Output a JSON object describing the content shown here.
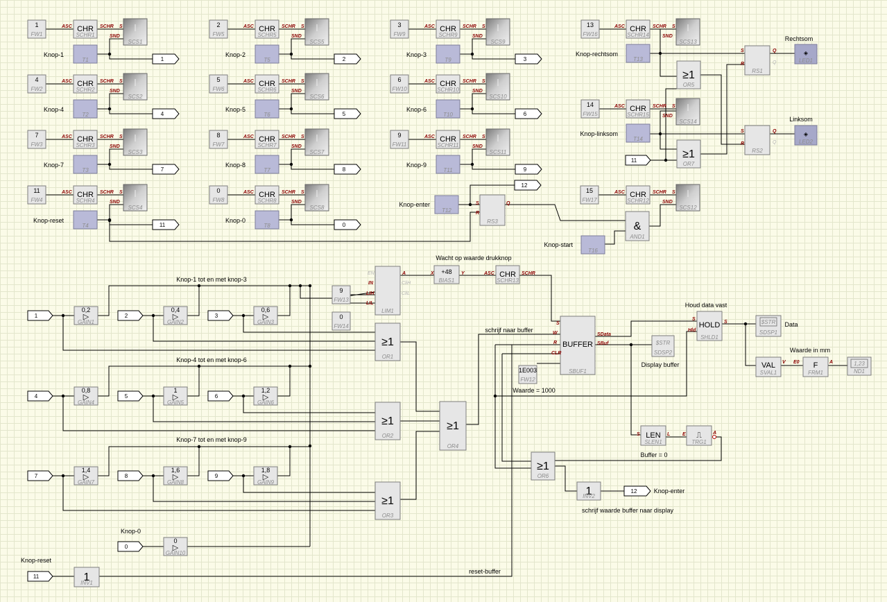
{
  "buttons": [
    {
      "label": "Knop-1",
      "fw_value": "1",
      "fw_id": "FW1",
      "chr_id": "SCHR1",
      "scs_id": "SCS1",
      "t_id": "T1",
      "out": "1"
    },
    {
      "label": "Knop-2",
      "fw_value": "2",
      "fw_id": "FW5",
      "chr_id": "SCHR5",
      "scs_id": "SCS5",
      "t_id": "T5",
      "out": "2"
    },
    {
      "label": "Knop-3",
      "fw_value": "3",
      "fw_id": "FW9",
      "chr_id": "SCHR9",
      "scs_id": "SCS9",
      "t_id": "T9",
      "out": "3"
    },
    {
      "label": "Knop-4",
      "fw_value": "4",
      "fw_id": "FW2",
      "chr_id": "SCHR2",
      "scs_id": "SCS2",
      "t_id": "T2",
      "out": "4"
    },
    {
      "label": "Knop-5",
      "fw_value": "5",
      "fw_id": "FW6",
      "chr_id": "SCHR6",
      "scs_id": "SCS6",
      "t_id": "T6",
      "out": "5"
    },
    {
      "label": "Knop-6",
      "fw_value": "6",
      "fw_id": "FW10",
      "chr_id": "SCHR10",
      "scs_id": "SCS10",
      "t_id": "T10",
      "out": "6"
    },
    {
      "label": "Knop-7",
      "fw_value": "7",
      "fw_id": "FW3",
      "chr_id": "SCHR3",
      "scs_id": "SCS3",
      "t_id": "T3",
      "out": "7"
    },
    {
      "label": "Knop-8",
      "fw_value": "8",
      "fw_id": "FW7",
      "chr_id": "SCHR7",
      "scs_id": "SCS7",
      "t_id": "T7",
      "out": "8"
    },
    {
      "label": "Knop-9",
      "fw_value": "9",
      "fw_id": "FW11",
      "chr_id": "SCHR11",
      "scs_id": "SCS11",
      "t_id": "T11",
      "out": "9"
    },
    {
      "label": "Knop-reset",
      "fw_value": "11",
      "fw_id": "FW4",
      "chr_id": "SCHR4",
      "scs_id": "SCS4",
      "t_id": "T4",
      "out": "11"
    },
    {
      "label": "Knop-0",
      "fw_value": "0",
      "fw_id": "FW8",
      "chr_id": "SCHR8",
      "scs_id": "SCS8",
      "t_id": "T8",
      "out": "0"
    }
  ],
  "rechtsom": {
    "label": "Knop-rechtsom",
    "fw_value": "13",
    "fw_id": "FW16",
    "chr_id": "SCHR14",
    "scs_id": "SCS13",
    "t_id": "T13",
    "or_id": "OR5",
    "rs_id": "RS1",
    "led_id": "LED1",
    "led_caption": "Rechtsom"
  },
  "linksom": {
    "label": "Knop-linksom",
    "fw_value": "14",
    "fw_id": "FW15",
    "chr_id": "SCHR15",
    "scs_id": "SCS14",
    "t_id": "T14",
    "or_id": "OR7",
    "rs_id": "RS2",
    "led_id": "LED2",
    "led_caption": "Linksom",
    "in_value": "11"
  },
  "enter": {
    "label": "Knop-enter",
    "t_id": "T12",
    "rs_id": "RS3",
    "out": "12"
  },
  "start": {
    "label": "Knop-start",
    "t_id": "T16",
    "and_id": "AND1",
    "fw_value": "15",
    "fw_id": "FW17",
    "chr_id": "SCHR12",
    "scs_id": "SCS12"
  },
  "pins": {
    "asc": "ASC",
    "schr": "SCHR",
    "s": "S",
    "snd": "SND",
    "r": "R",
    "q": "Q",
    "q2": "Q",
    "x": "X",
    "y": "Y",
    "a": "A",
    "en": "EN",
    "in": "IN",
    "lih": "LIH",
    "lil": "LIL",
    "clih": "CliH",
    "clil": "CliL",
    "w": "W",
    "clr": "CLR",
    "sdata": "SData",
    "sbuf": "SBuf",
    "hld": "Hld",
    "v": "V",
    "e0": "E0",
    "l": "L",
    "e": "E"
  },
  "symbols": {
    "chr": "CHR",
    "or": "≥1",
    "and": "&",
    "inv": "1",
    "gain": "▷",
    "buffer": "BUFFER",
    "hold": "HOLD",
    "val": "VAL",
    "frm": "F",
    "len": "LEN",
    "trg": "⎍",
    "sdsp": "$STR",
    "nd": "1,23",
    "led": "◈"
  },
  "gain_values": [
    "0,2",
    "0,4",
    "0,6",
    "0,8",
    "1",
    "1,2",
    "1,4",
    "1,6",
    "1,8",
    "0"
  ],
  "gain_ids": [
    "GAIN1",
    "GAIN2",
    "GAIN3",
    "GAIN4",
    "GAIN5",
    "GAIN6",
    "GAIN7",
    "GAIN8",
    "GAIN9",
    "GAIN10"
  ],
  "gain_inputs": [
    "1",
    "2",
    "3",
    "4",
    "5",
    "6",
    "7",
    "8",
    "9",
    "0"
  ],
  "or_ids": {
    "or1": "OR1",
    "or2": "OR2",
    "or3": "OR3",
    "or4": "OR4",
    "or6": "OR6"
  },
  "lim": {
    "id": "LIM1",
    "fw13_value": "9",
    "fw13_id": "FW13",
    "fw14_value": "0",
    "fw14_id": "FW14"
  },
  "bias": {
    "value": "+48",
    "id": "BIAS1"
  },
  "schr13": {
    "id": "SCHR13"
  },
  "buffer": {
    "id": "SBUF1",
    "fw12_value": "1E003",
    "fw12_id": "FW12"
  },
  "hold": {
    "id": "SHLD1"
  },
  "sdsp1": {
    "id": "SDSP1"
  },
  "sdsp2": {
    "id": "SDSP2"
  },
  "val": {
    "id": "SVAL1"
  },
  "frm": {
    "id": "FRM1"
  },
  "nd": {
    "id": "ND1"
  },
  "len": {
    "id": "SLEN1"
  },
  "trg": {
    "id": "TRG1"
  },
  "inv1": {
    "id": "INV1",
    "in": "11"
  },
  "inv2": {
    "id": "INV2",
    "out": "12"
  },
  "captions": {
    "group1": "Knop-1 tot en met knop-3",
    "group2": "Knop-4 tot en met knop-6",
    "group3": "Knop-7 tot en met knop-9",
    "wacht": "Wacht op waarde drukknop",
    "schrijf": "schrijf naar buffer",
    "houd": "Houd data vast",
    "data": "Data",
    "waarde_mm": "Waarde in mm",
    "display_buffer": "Display buffer",
    "waarde_1000": "Waarde = 1000",
    "buffer0": "Buffer = 0",
    "knop_enter": "Knop-enter",
    "schrijf_display": "schrijf waarde buffer naar display",
    "knop0": "Knop-0",
    "knop_reset": "Knop-reset",
    "reset_buffer": "reset-buffer"
  }
}
